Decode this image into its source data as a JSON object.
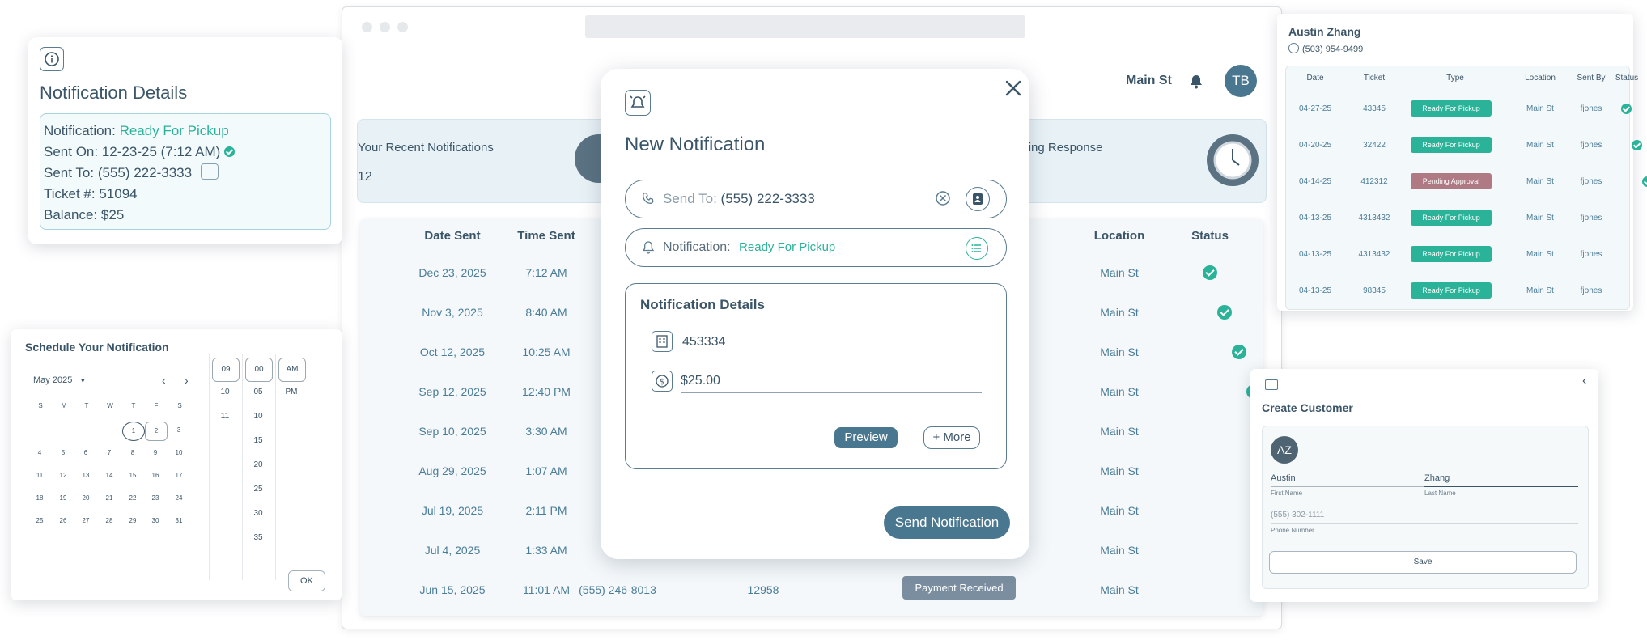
{
  "main": {
    "header": {
      "location": "Main St",
      "avatar": "TB"
    },
    "stats": [
      {
        "label": "Your Recent Notifications",
        "value": "12"
      },
      {
        "label": "ions Pending Response"
      }
    ],
    "table": {
      "headers": [
        "Date Sent",
        "Time Sent",
        "Location",
        "Status"
      ],
      "rows": [
        {
          "date": "Dec 23, 2025",
          "time": "7:12 AM",
          "location": "Main St"
        },
        {
          "date": "Nov 3, 2025",
          "time": "8:40 AM",
          "location": "Main St"
        },
        {
          "date": "Oct 12, 2025",
          "time": "10:25 AM",
          "location": "Main St"
        },
        {
          "date": "Sep 12, 2025",
          "time": "12:40 PM",
          "location": "Main St"
        },
        {
          "date": "Sep 10, 2025",
          "time": "3:30 AM",
          "location": "Main St"
        },
        {
          "date": "Aug 29, 2025",
          "time": "1:07 AM",
          "location": "Main St"
        },
        {
          "date": "Jul 19, 2025",
          "time": "2:11 PM",
          "location": "Main St"
        },
        {
          "date": "Jul 4, 2025",
          "time": "1:33 AM",
          "location": "Main St"
        },
        {
          "date": "Jun 15, 2025",
          "time": "11:01 AM",
          "location": "Main St",
          "phone": "(555) 246-8013",
          "ticket": "12958",
          "type": "Payment Received"
        }
      ]
    }
  },
  "details": {
    "title": "Notification Details",
    "notification_label": "Notification:",
    "notification_value": "Ready For Pickup",
    "sent_on_label": "Sent On:",
    "sent_on_value": "12-23-25 (7:12 AM)",
    "sent_to_label": "Sent To:",
    "sent_to_value": "(555) 222-3333",
    "ticket_label": "Ticket #:",
    "ticket_value": "51094",
    "balance_label": "Balance:",
    "balance_value": "$25"
  },
  "modal": {
    "title": "New Notification",
    "send_to_label": "Send To:",
    "send_to_value": "(555) 222-3333",
    "notification_label": "Notification:",
    "notification_value": "Ready For Pickup",
    "details_title": "Notification Details",
    "ticket_value": "453334",
    "amount_value": "$25.00",
    "preview_button": "Preview",
    "more_button": "+ More",
    "send_button": "Send Notification"
  },
  "schedule": {
    "title": "Schedule Your Notification",
    "month": "May 2025",
    "weekdays": [
      "S",
      "M",
      "T",
      "W",
      "T",
      "F",
      "S"
    ],
    "weeks": [
      [
        "",
        "",
        "",
        "",
        "1",
        "2",
        "3"
      ],
      [
        "4",
        "5",
        "6",
        "7",
        "8",
        "9",
        "10"
      ],
      [
        "11",
        "12",
        "13",
        "14",
        "15",
        "16",
        "17"
      ],
      [
        "18",
        "19",
        "20",
        "21",
        "22",
        "23",
        "24"
      ],
      [
        "25",
        "26",
        "27",
        "28",
        "29",
        "30",
        "31"
      ]
    ],
    "hours": [
      "09",
      "10",
      "11"
    ],
    "minutes": [
      "00",
      "05",
      "10",
      "15",
      "20",
      "25",
      "30",
      "35"
    ],
    "ampm": [
      "AM",
      "PM"
    ],
    "ok_button": "OK"
  },
  "history": {
    "name": "Austin Zhang",
    "phone": "(503) 954-9499",
    "headers": [
      "Date",
      "Ticket",
      "Type",
      "Location",
      "Sent By",
      "Status"
    ],
    "rows": [
      {
        "date": "04-27-25",
        "ticket": "43345",
        "type": "Ready For Pickup",
        "location": "Main St",
        "by": "fjones"
      },
      {
        "date": "04-20-25",
        "ticket": "32422",
        "type": "Ready For Pickup",
        "location": "Main St",
        "by": "fjones"
      },
      {
        "date": "04-14-25",
        "ticket": "412312",
        "type": "Pending Approval",
        "location": "Main St",
        "by": "fjones"
      },
      {
        "date": "04-13-25",
        "ticket": "4313432",
        "type": "Ready For Pickup",
        "location": "Main St",
        "by": "fjones"
      },
      {
        "date": "04-13-25",
        "ticket": "4313432",
        "type": "Ready For Pickup",
        "location": "Main St",
        "by": "fjones"
      },
      {
        "date": "04-13-25",
        "ticket": "98345",
        "type": "Ready For Pickup",
        "location": "Main St",
        "by": "fjones"
      }
    ]
  },
  "customer": {
    "title": "Create Customer",
    "avatar": "AZ",
    "first_name": "Austin",
    "first_name_label": "First Name",
    "last_name": "Zhang",
    "last_name_label": "Last Name",
    "phone_placeholder": "(555) 302-1111",
    "phone_label": "Phone Number",
    "save_button": "Save"
  },
  "colors": {
    "accent": "#2bb39a",
    "primary": "#4a7790",
    "text": "#3b5568",
    "pending": "#b07a84",
    "tag_grey": "#7a8ea0"
  }
}
